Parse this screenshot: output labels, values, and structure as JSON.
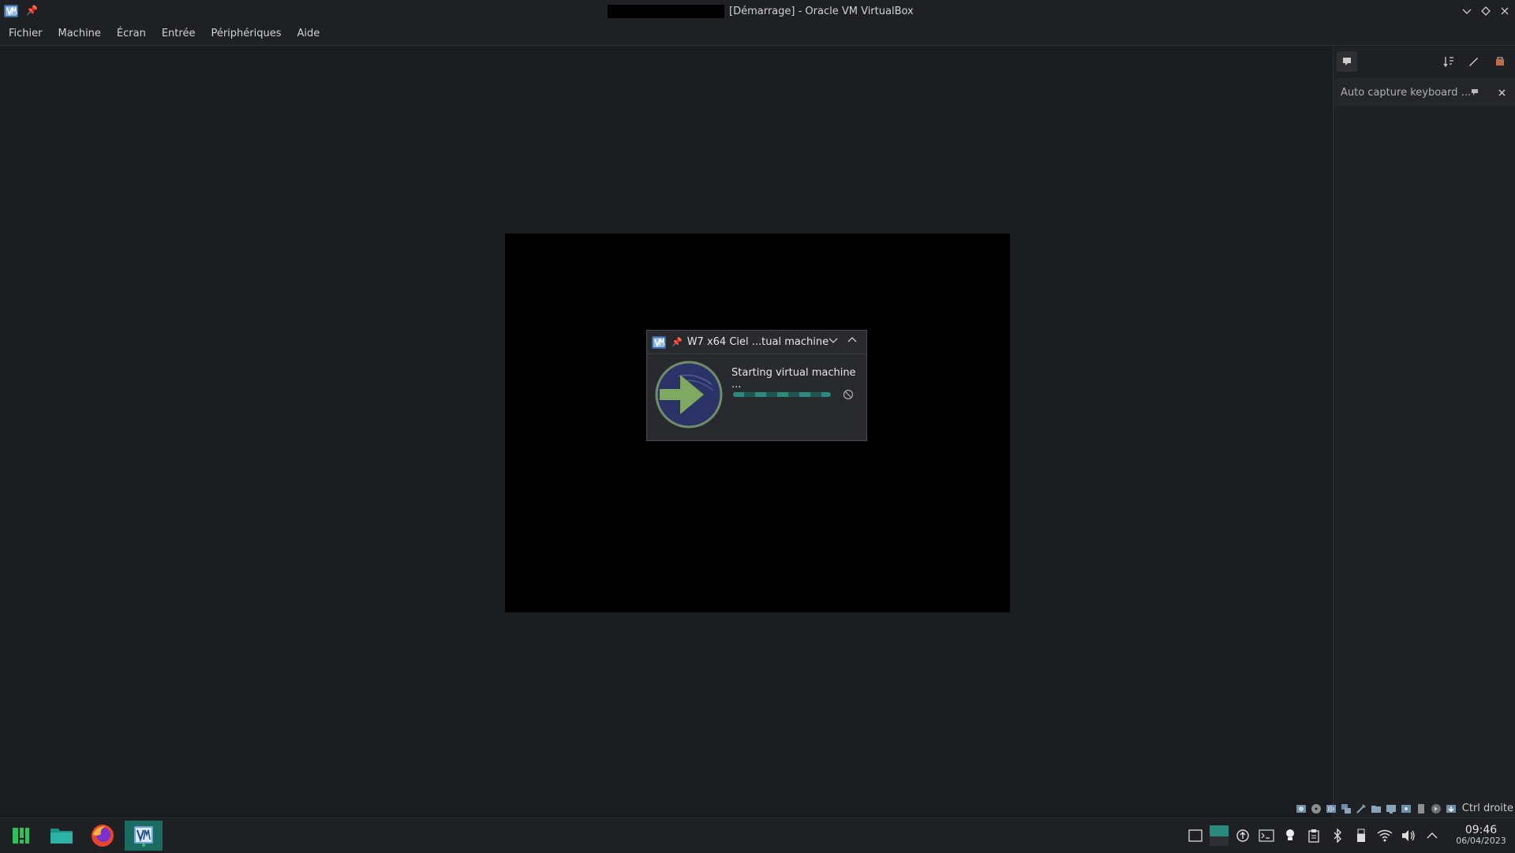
{
  "window": {
    "title": "[Démarrage] - Oracle VM VirtualBox",
    "pin_glyph": "📌",
    "controls": [
      "chevron-down-icon",
      "restore-icon",
      "close-icon"
    ]
  },
  "menu": {
    "items": [
      {
        "label": "Fichier"
      },
      {
        "label": "Machine"
      },
      {
        "label": "Écran"
      },
      {
        "label": "Entrée"
      },
      {
        "label": "Périphériques"
      },
      {
        "label": "Aide"
      }
    ]
  },
  "popup": {
    "title": "W7 x64 Ciel ...tual machine",
    "message": "Starting virtual machine ...",
    "progress_fraction": 0.5,
    "accent": "#2a8a7e"
  },
  "sidepanel": {
    "notification": "Auto capture keyboard ...",
    "icons": [
      "notification-center-icon",
      "sort-icon",
      "settings-brush-icon",
      "clear-icon"
    ]
  },
  "statusbar": {
    "host_key": "Ctrl droite",
    "icons": [
      "hard-disk-icon",
      "optical-drive-icon",
      "audio-icon",
      "network-icon",
      "usb-icon",
      "shared-folder-icon",
      "display-icon",
      "recording-icon",
      "cpu-icon",
      "mouse-integration-icon",
      "keyboard-icon"
    ]
  },
  "taskbar": {
    "apps": [
      "app-launcher-icon",
      "file-manager-icon",
      "firefox-icon",
      "virtualbox-icon"
    ],
    "tray": [
      "show-desktop-icon",
      "pager-icon",
      "update-icon",
      "terminal-icon",
      "lightbulb-icon",
      "clipboard-icon",
      "bluetooth-icon",
      "usb-device-icon",
      "wifi-icon",
      "volume-icon",
      "expand-tray-icon"
    ],
    "clock": {
      "time": "09:46",
      "date": "06/04/2023"
    }
  }
}
